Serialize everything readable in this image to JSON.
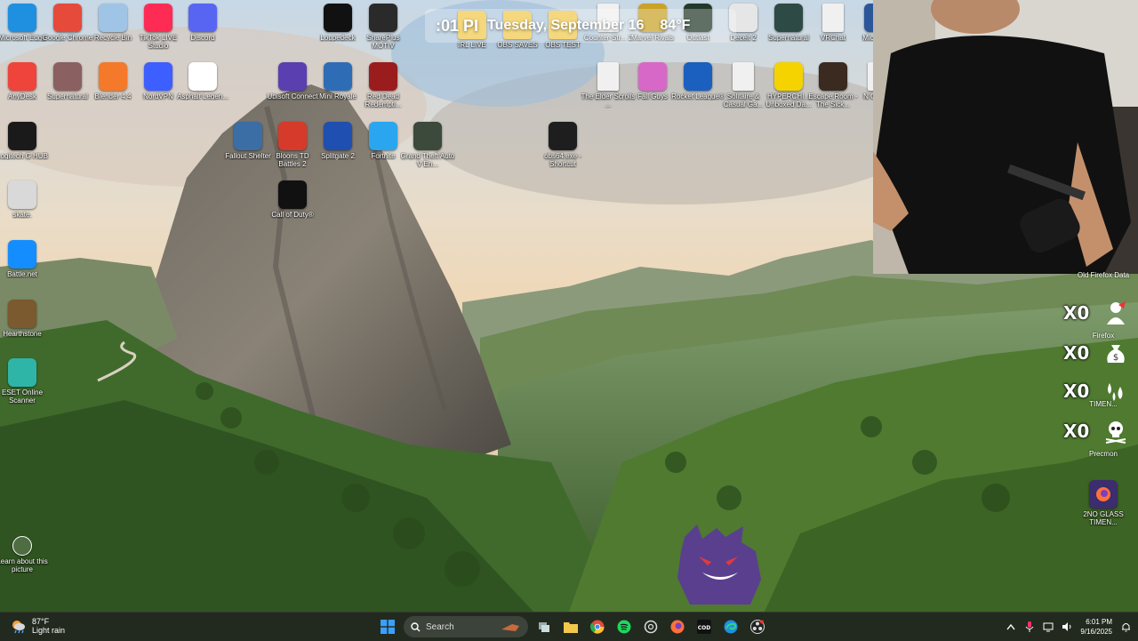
{
  "widget": {
    "time": ":01 PI",
    "date": "Tuesday, September 16",
    "temp": "84°F"
  },
  "desktop_icons": [
    {
      "label": "Microsoft Edge",
      "icon": "edge-icon",
      "color": "#1f8fe0"
    },
    {
      "label": "Google Chrome",
      "icon": "chrome-icon",
      "color": "#e64a3b"
    },
    {
      "label": "Recycle Bin",
      "icon": "recycle-bin-icon",
      "color": "#9fc4e6"
    },
    {
      "label": "TikTok LIVE Studio",
      "icon": "tiktok-icon",
      "color": "#fe2c55"
    },
    {
      "label": "Discord",
      "icon": "discord-icon",
      "color": "#5865f2"
    },
    {
      "label": "AnyDesk",
      "icon": "anydesk-icon",
      "color": "#ef443b"
    },
    {
      "label": "Supernatural",
      "icon": "supernatural-icon",
      "color": "#8a6060"
    },
    {
      "label": "Blender 4.4",
      "icon": "blender-icon",
      "color": "#f5792a"
    },
    {
      "label": "NordVPN",
      "icon": "nordvpn-icon",
      "color": "#3e5fff"
    },
    {
      "label": "Asphalt Legen...",
      "icon": "asphalt-icon",
      "color": "#ffffff"
    },
    {
      "label": "Logitech G HUB",
      "icon": "logitech-icon",
      "color": "#1a1a1a"
    },
    {
      "label": "skate.",
      "icon": "skate-icon",
      "color": "#d9d9d9"
    },
    {
      "label": "Battle.net",
      "icon": "battlenet-icon",
      "color": "#148eff"
    },
    {
      "label": "Hearthstone",
      "icon": "hearthstone-icon",
      "color": "#7a5a2e"
    },
    {
      "label": "ESET Online Scanner",
      "icon": "eset-icon",
      "color": "#2fb5a8"
    },
    {
      "label": "Loupedeck",
      "icon": "loupedeck-icon",
      "color": "#111111"
    },
    {
      "label": "SharePlus MOTIV",
      "icon": "shureplus-icon",
      "color": "#2a2a2a"
    },
    {
      "label": "Ubisoft Connect",
      "icon": "ubisoft-icon",
      "color": "#5a3fb0"
    },
    {
      "label": "Mini Royale",
      "icon": "mini-royale-icon",
      "color": "#2e6db5"
    },
    {
      "label": "Red Dead Redempti...",
      "icon": "red-dead-icon",
      "color": "#9a1c1c"
    },
    {
      "label": "Fallout Shelter",
      "icon": "fallout-icon",
      "color": "#3a6ea5"
    },
    {
      "label": "Bloons TD Battles 2",
      "icon": "bloons-icon",
      "color": "#d63a2a"
    },
    {
      "label": "Splitgate 2",
      "icon": "splitgate-icon",
      "color": "#1f4fb0"
    },
    {
      "label": "Fortnite",
      "icon": "fortnite-icon",
      "color": "#2aa6f0"
    },
    {
      "label": "Grand Theft Auto V En...",
      "icon": "gta-icon",
      "color": "#3b4a3a"
    },
    {
      "label": "Call of Duty®",
      "icon": "call-of-duty-icon",
      "color": "#111111"
    },
    {
      "label": "obs64.exe - Shortcut",
      "icon": "obs-icon",
      "color": "#1e1e1e"
    },
    {
      "label": "IRL LIVE",
      "icon": "folder-icon",
      "color": "#f2c94c"
    },
    {
      "label": "OBS SAVES",
      "icon": "folder-icon",
      "color": "#f2c94c"
    },
    {
      "label": "OBS TEST",
      "icon": "folder-icon",
      "color": "#f2c94c"
    },
    {
      "label": "Counter-Str... 2",
      "icon": "document-icon",
      "color": "#f0f0f0"
    },
    {
      "label": "Marvel Rivals",
      "icon": "marvel-rivals-icon",
      "color": "#c9a227"
    },
    {
      "label": "Outlast",
      "icon": "outlast-icon",
      "color": "#233a2a"
    },
    {
      "label": "Deceit 2",
      "icon": "deceit-icon",
      "color": "#e6e6e6"
    },
    {
      "label": "Supernatural",
      "icon": "supernatural-2-icon",
      "color": "#2e4a44"
    },
    {
      "label": "VRChat",
      "icon": "document-icon",
      "color": "#f0f0f0"
    },
    {
      "label": "Micr Ultim",
      "icon": "word-icon",
      "color": "#2b579a"
    },
    {
      "label": "The Elder Scrolls ...",
      "icon": "document-icon",
      "color": "#f0f0f0"
    },
    {
      "label": "Fall Guys",
      "icon": "fall-guys-icon",
      "color": "#d868c8"
    },
    {
      "label": "Rocket League®",
      "icon": "rocket-league-icon",
      "color": "#1b5fbf"
    },
    {
      "label": "Solitaire & Casual Ga...",
      "icon": "document-icon",
      "color": "#f0f0f0"
    },
    {
      "label": "HYPERCHI... Unboxed Da...",
      "icon": "hyperchip-icon",
      "color": "#f5d300"
    },
    {
      "label": "Escape Room - The Sick...",
      "icon": "escape-room-icon",
      "color": "#3a2a20"
    },
    {
      "label": "N G PRO",
      "icon": "document-icon",
      "color": "#f0f0f0"
    },
    {
      "label": "Learn about this picture",
      "icon": "learn-about-picture-icon",
      "color": "rgba(255,255,255,0.15)"
    }
  ],
  "side_labels": {
    "old_firefox": "Old Firefox Data",
    "firefox": "Firefox",
    "timen": "TIMEN...",
    "precmon": "Precmon",
    "glass_timen": "2NO GLASS TIMEN..."
  },
  "counters": [
    {
      "value": "X0",
      "icon": "player-icon"
    },
    {
      "value": "X0",
      "icon": "money-bag-icon"
    },
    {
      "value": "X0",
      "icon": "drops-icon"
    },
    {
      "value": "X0",
      "icon": "skull-icon"
    }
  ],
  "taskbar": {
    "weather_temp": "87°F",
    "weather_desc": "Light rain",
    "search_placeholder": "Search",
    "time": "6:01 PM",
    "date": "9/16/2025",
    "apps": [
      "start-icon",
      "search",
      "task-view-icon",
      "file-explorer-icon",
      "chrome-icon",
      "spotify-icon",
      "chatgpt-icon",
      "firefox-icon",
      "call-of-duty-icon",
      "edge-icon",
      "obs-icon"
    ]
  }
}
